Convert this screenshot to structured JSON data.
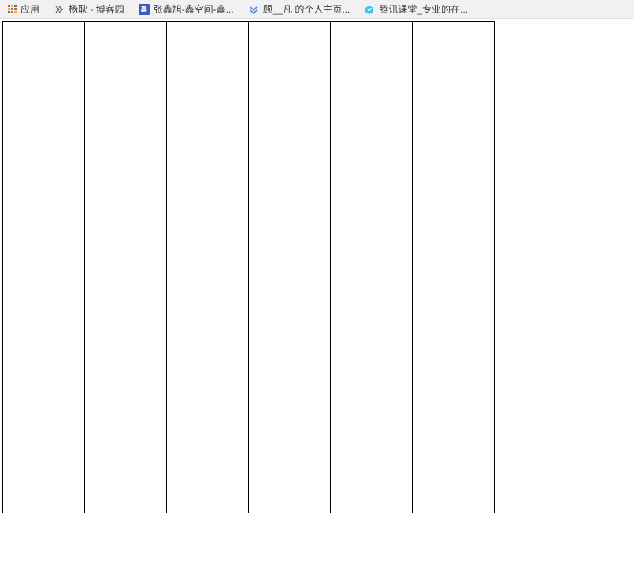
{
  "bookmarks": {
    "apps_label": "应用",
    "items": [
      {
        "label": "杨耿 - 博客园",
        "icon": "cnblogs"
      },
      {
        "label": "张鑫旭-鑫空间-鑫...",
        "icon": "zxx"
      },
      {
        "label": "顾__凡 的个人主页...",
        "icon": "chevrons"
      },
      {
        "label": "腾讯课堂_专业的在...",
        "icon": "tencent"
      }
    ]
  },
  "grid": {
    "columns": 6
  }
}
